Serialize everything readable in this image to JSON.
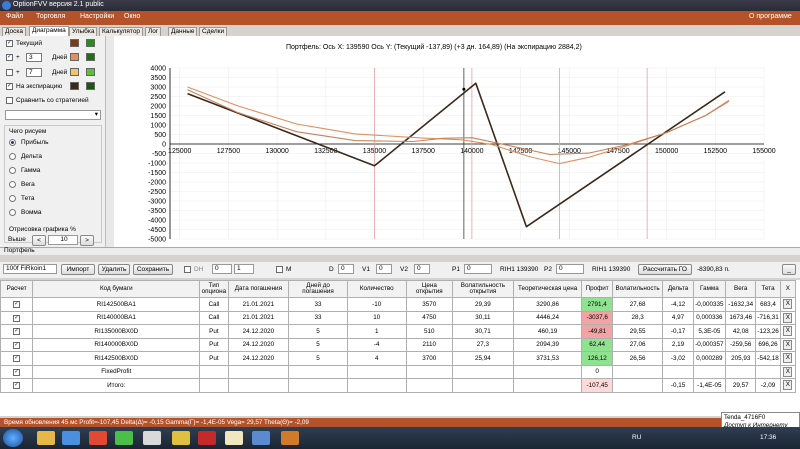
{
  "app": {
    "title": "OptionFVV версия 2.1 public"
  },
  "menu": {
    "items": [
      "Файл",
      "Торговля",
      "Настройки",
      "Окно"
    ],
    "about": "О программе"
  },
  "tabs": [
    "Доска",
    "Диаграмма",
    "Улыбка",
    "Калькулятор",
    "Лог",
    "Данные",
    "Сделки"
  ],
  "left_panel": {
    "current_label": "Текущий",
    "day_label": "Дней",
    "day1_value": "3",
    "day2_value": "7",
    "expiry_label": "На экспирацию",
    "compare_label": "Сравнить со стратегией",
    "draw_label": "Чего рисуем",
    "options": [
      "Прибыль",
      "Дельта",
      "Гамма",
      "Вега",
      "Тета",
      "Вомма"
    ],
    "rendering_label": "Отрисовка графика %",
    "above_label": "Выше",
    "above_value": "10",
    "colors": {
      "current": "#7a3d14",
      "day1": "#e09060",
      "day2": "#f2c36a",
      "expiry": "#3b2a1a",
      "green1": "#2a8a1a",
      "green2": "#1f6e12",
      "green3": "#5bbf3a"
    }
  },
  "chart": {
    "title": "Портфель: Ось X: 139590 Ось Y:  (Текущий -137,89)  (+3 дн. 164,89)  (На экспирацию 2884,2)"
  },
  "chart_data": {
    "type": "line",
    "x_ticks": [
      "125000",
      "127500",
      "130000",
      "132500",
      "135000",
      "137500",
      "140000",
      "142500",
      "145000",
      "147500",
      "150000",
      "152500",
      "155000"
    ],
    "y_ticks": [
      "4000",
      "3500",
      "3000",
      "2500",
      "2000",
      "1500",
      "1000",
      "500",
      "0",
      "-500",
      "-1000",
      "-1500",
      "-2000",
      "-2500",
      "-3000",
      "-3500",
      "-4000",
      "-4500",
      "-5000"
    ],
    "xlim": [
      124500,
      155000
    ],
    "ylim": [
      -5000,
      4000
    ],
    "vlines": [
      135000,
      139590,
      140000,
      144500,
      149000
    ],
    "cursor_x": 139590,
    "series": [
      {
        "color": "#3b2a1a",
        "points": [
          [
            125400,
            2650
          ],
          [
            135000,
            -1150
          ],
          [
            140200,
            3200
          ],
          [
            142800,
            -4350
          ],
          [
            153000,
            2750
          ]
        ]
      },
      {
        "color": "#e09060",
        "points": [
          [
            125400,
            3000
          ],
          [
            128000,
            2000
          ],
          [
            131000,
            1050
          ],
          [
            134000,
            530
          ],
          [
            137500,
            310
          ],
          [
            139500,
            220
          ],
          [
            141000,
            -20
          ],
          [
            143000,
            -680
          ],
          [
            144500,
            -1030
          ],
          [
            146000,
            -700
          ],
          [
            148000,
            -80
          ],
          [
            150000,
            600
          ],
          [
            152000,
            1500
          ],
          [
            153200,
            2300
          ]
        ]
      },
      {
        "color": "#c8825a",
        "points": [
          [
            125400,
            2850
          ],
          [
            128000,
            1650
          ],
          [
            131000,
            650
          ],
          [
            134000,
            180
          ],
          [
            137000,
            130
          ],
          [
            138500,
            300
          ],
          [
            140000,
            330
          ],
          [
            142000,
            -100
          ],
          [
            144000,
            -550
          ],
          [
            146000,
            -480
          ],
          [
            148000,
            -30
          ],
          [
            150000,
            600
          ],
          [
            152000,
            1500
          ],
          [
            153200,
            2250
          ]
        ]
      }
    ]
  },
  "portfolio": {
    "header_label": "Портфель",
    "account": "100f FiRkoin1",
    "import_label": "Импорт",
    "delete_label": "Удалить",
    "save_label": "Сохранить",
    "dh_label": "DH",
    "dh1": "0",
    "dh2": "1",
    "m_label": "M",
    "d_label": "D",
    "d_value": "0",
    "v1_label": "V1",
    "v1_value": "0",
    "v2_label": "V2",
    "v2_value": "0",
    "p1_label": "P1",
    "p1_value": "0",
    "rih1_a": "RIH1 139390",
    "p2_label": "P2",
    "p2_value": "0",
    "rih1_b": "RIH1 139390",
    "calc_go_label": "Рассчитать ГО",
    "go_value": "-8390,83 п.",
    "minimize_label": "_",
    "columns": [
      "Расчет",
      "Код бумаги",
      "Тип опциона",
      "Дата погашения",
      "Дней до погашения",
      "Количество",
      "Цена открытия",
      "Волатильность открытия",
      "Теоретическая цена",
      "Профит",
      "Волатильность",
      "Дельта",
      "Гамма",
      "Вега",
      "Тета",
      "X"
    ],
    "rows": [
      [
        "RI142500BA1",
        "Call",
        "21.01.2021",
        "33",
        "-10",
        "3570",
        "29,39",
        "3290,86",
        "2791,4",
        "27,68",
        "-4,12",
        "-0,000335",
        "-1632,34",
        "683,4"
      ],
      [
        "RI140000BA1",
        "Call",
        "21.01.2021",
        "33",
        "10",
        "4750",
        "30,11",
        "4446,24",
        "-3037,6",
        "28,3",
        "4,97",
        "0,000336",
        "1673,46",
        "-716,31"
      ],
      [
        "RI135000BX0D",
        "Put",
        "24.12.2020",
        "5",
        "1",
        "510",
        "30,71",
        "460,19",
        "-49,81",
        "29,55",
        "-0,17",
        "5,3E-05",
        "42,08",
        "-123,26"
      ],
      [
        "RI140000BX0D",
        "Put",
        "24.12.2020",
        "5",
        "-4",
        "2110",
        "27,3",
        "2094,39",
        "62,44",
        "27,06",
        "2,19",
        "-0,000357",
        "-259,56",
        "696,26"
      ],
      [
        "RI142500BX0D",
        "Put",
        "24.12.2020",
        "5",
        "4",
        "3700",
        "25,94",
        "3731,53",
        "126,12",
        "26,56",
        "-3,02",
        "0,000289",
        "205,93",
        "-542,18"
      ],
      [
        "FixedProfit",
        "",
        "",
        "",
        "",
        "",
        "",
        "",
        "0",
        "",
        "",
        "",
        "",
        "",
        ""
      ],
      [
        "Итого:",
        "",
        "",
        "",
        "",
        "",
        "",
        "",
        "-107,45",
        "",
        "-0,15",
        "-1,4E-05",
        "29,57",
        "-2,09"
      ]
    ]
  },
  "status": {
    "text": "Время обновления 45 мс  Profit=-107,45 Delta(Δ)= -0,15 Gamma(Γ)= -1,4E-05 Vega= 29,57 Theta(Θ)= -2,09"
  },
  "tooltip": {
    "line1": "Tenda_4716F0",
    "line2": "Доступ к Интернету"
  },
  "taskbar": {
    "lang": "RU",
    "time": "17:36"
  }
}
